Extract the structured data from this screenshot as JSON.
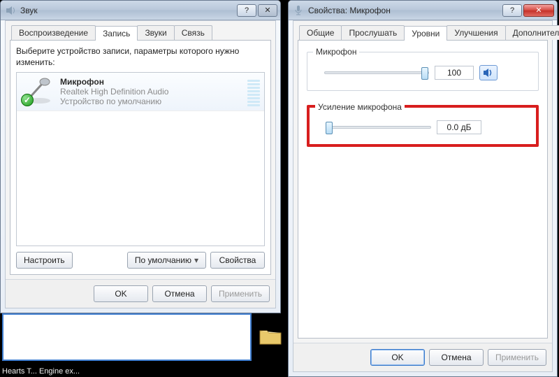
{
  "sound_window": {
    "title": "Звук",
    "tabs": {
      "playback": "Воспроизведение",
      "recording": "Запись",
      "sounds": "Звуки",
      "comms": "Связь"
    },
    "instruction": "Выберите устройство записи, параметры которого нужно изменить:",
    "device": {
      "name": "Микрофон",
      "driver": "Realtek High Definition Audio",
      "default": "Устройство по умолчанию"
    },
    "buttons": {
      "configure": "Настроить",
      "setdefault": "По умолчанию",
      "properties": "Свойства",
      "ok": "OK",
      "cancel": "Отмена",
      "apply": "Применить"
    }
  },
  "prop_window": {
    "title": "Свойства: Микрофон",
    "tabs": {
      "general": "Общие",
      "listen": "Прослушать",
      "levels": "Уровни",
      "enhance": "Улучшения",
      "advanced": "Дополнительно"
    },
    "mic_group": {
      "legend": "Микрофон",
      "value": "100"
    },
    "boost_group": {
      "legend": "Усиление микрофона",
      "value": "0.0 дБ"
    },
    "buttons": {
      "ok": "OK",
      "cancel": "Отмена",
      "apply": "Применить"
    }
  },
  "desktop": {
    "file_label": "Hearts T...   Engine ex..."
  }
}
